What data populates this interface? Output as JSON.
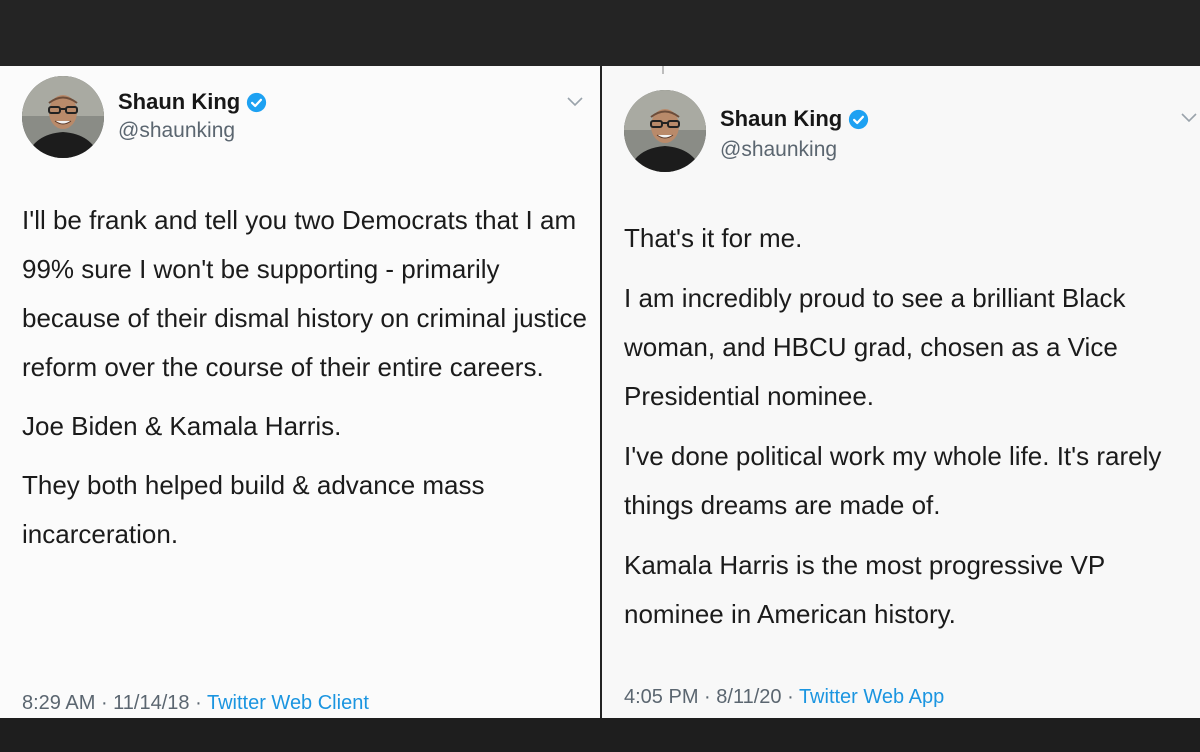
{
  "tweets": [
    {
      "name": "Shaun King",
      "handle": "@shaunking",
      "avatar_icon": "profile-photo",
      "verified_icon": "verified-badge-icon",
      "menu_icon": "chevron-down-icon",
      "paragraphs": [
        "I'll be frank and tell you two Democrats that I am 99% sure I won't be supporting - primarily because of their dismal history on criminal justice reform over the course of their entire careers.",
        "Joe Biden & Kamala Harris.",
        "They both helped build & advance mass incarceration."
      ],
      "time": "8:29 AM",
      "date": "11/14/18",
      "source": "Twitter Web Client"
    },
    {
      "name": "Shaun King",
      "handle": "@shaunking",
      "avatar_icon": "profile-photo",
      "verified_icon": "verified-badge-icon",
      "menu_icon": "chevron-down-icon",
      "paragraphs": [
        "That's it for me.",
        "I am incredibly proud to see a brilliant Black woman, and HBCU grad, chosen as a Vice Presidential nominee.",
        "I've done political work my whole life. It's rarely things dreams are made of.",
        "Kamala Harris is the most progressive VP nominee in American history."
      ],
      "time": "4:05 PM",
      "date": "8/11/20",
      "source": "Twitter Web App"
    }
  ],
  "meta_separator": " · ",
  "colors": {
    "link": "#1b95e0",
    "verified": "#1da1f2",
    "text": "#1b1b1b",
    "muted": "#5b6670"
  }
}
